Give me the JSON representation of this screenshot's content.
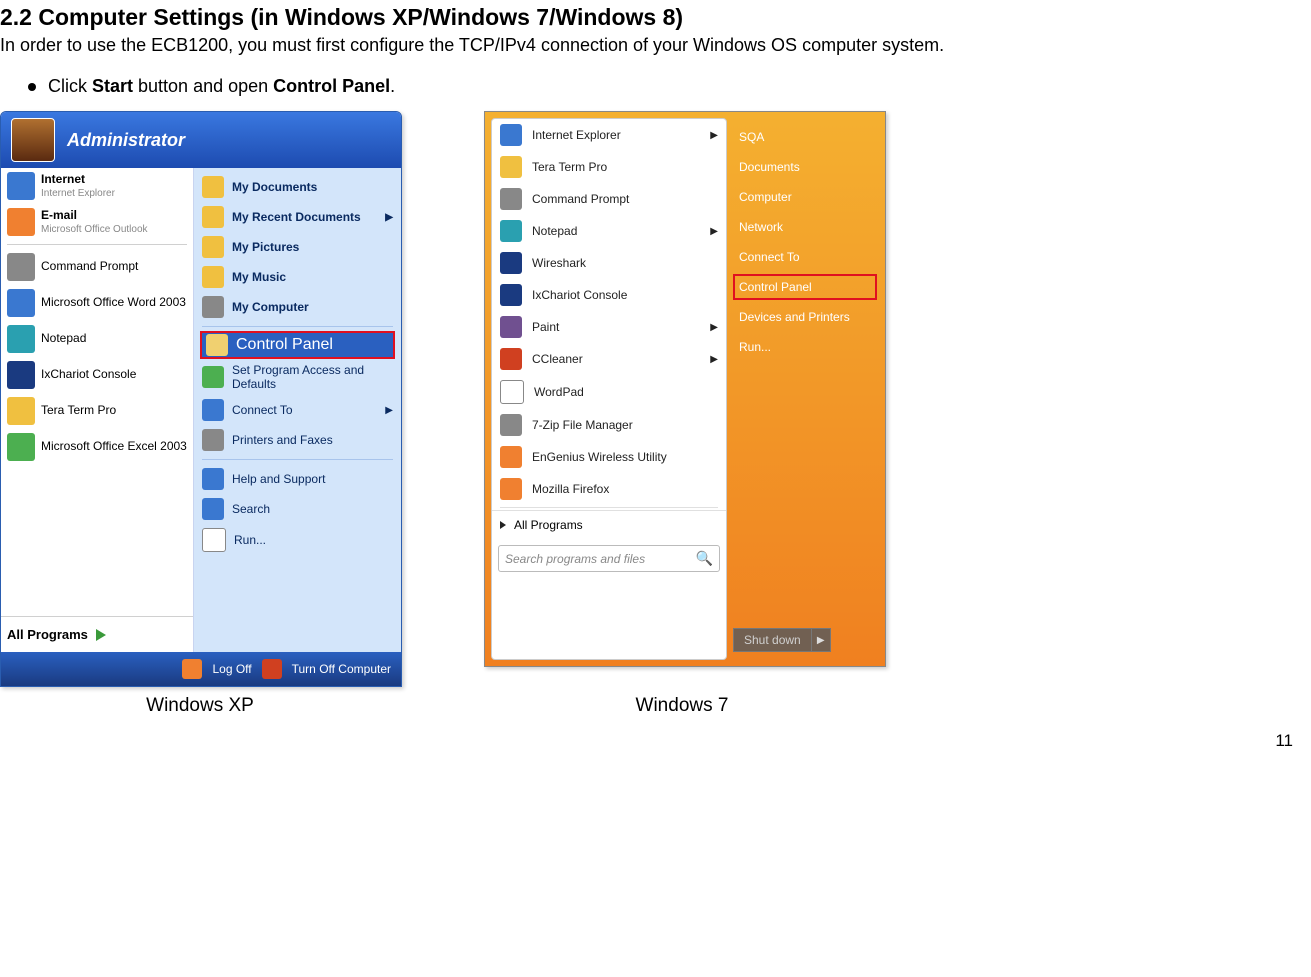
{
  "doc": {
    "heading": "2.2   Computer Settings (in Windows XP/Windows 7/Windows 8)",
    "intro": "In order to use the ECB1200, you must first configure the TCP/IPv4 connection of your Windows OS computer system.",
    "bullet_pre": "Click ",
    "bullet_bold1": "Start",
    "bullet_mid": " button and open ",
    "bullet_bold2": "Control Panel",
    "bullet_end": ".",
    "caption_xp": "Windows XP",
    "caption_w7": "Windows 7",
    "page_number": "11"
  },
  "xp": {
    "user": "Administrator",
    "left": {
      "internet_label": "Internet",
      "internet_sub": "Internet Explorer",
      "email_label": "E-mail",
      "email_sub": "Microsoft Office Outlook",
      "items": [
        "Command Prompt",
        "Microsoft Office Word 2003",
        "Notepad",
        "IxChariot Console",
        "Tera Term Pro",
        "Microsoft Office Excel 2003"
      ],
      "all_programs": "All Programs"
    },
    "right": {
      "top": [
        "My Documents",
        "My Recent Documents",
        "My Pictures",
        "My Music",
        "My Computer"
      ],
      "control_panel": "Control Panel",
      "mid": [
        "Set Program Access and Defaults",
        "Connect To",
        "Printers and Faxes"
      ],
      "bottom": [
        "Help and Support",
        "Search",
        "Run..."
      ]
    },
    "footer": {
      "logoff": "Log Off",
      "turnoff": "Turn Off Computer"
    }
  },
  "w7": {
    "left_items": [
      {
        "label": "Internet Explorer",
        "arrow": true
      },
      {
        "label": "Tera Term Pro",
        "arrow": false
      },
      {
        "label": "Command Prompt",
        "arrow": false
      },
      {
        "label": "Notepad",
        "arrow": true
      },
      {
        "label": "Wireshark",
        "arrow": false
      },
      {
        "label": "IxChariot Console",
        "arrow": false
      },
      {
        "label": "Paint",
        "arrow": true
      },
      {
        "label": "CCleaner",
        "arrow": true
      },
      {
        "label": "WordPad",
        "arrow": false
      },
      {
        "label": "7-Zip File Manager",
        "arrow": false
      },
      {
        "label": "EnGenius Wireless Utility",
        "arrow": false
      },
      {
        "label": "Mozilla Firefox",
        "arrow": false
      }
    ],
    "all_programs": "All Programs",
    "search_placeholder": "Search programs and files",
    "right": {
      "items_top": [
        "SQA",
        "Documents",
        "Computer",
        "Network",
        "Connect To"
      ],
      "control_panel": "Control Panel",
      "items_bottom": [
        "Devices and Printers",
        "Run..."
      ]
    },
    "shutdown": "Shut down"
  }
}
